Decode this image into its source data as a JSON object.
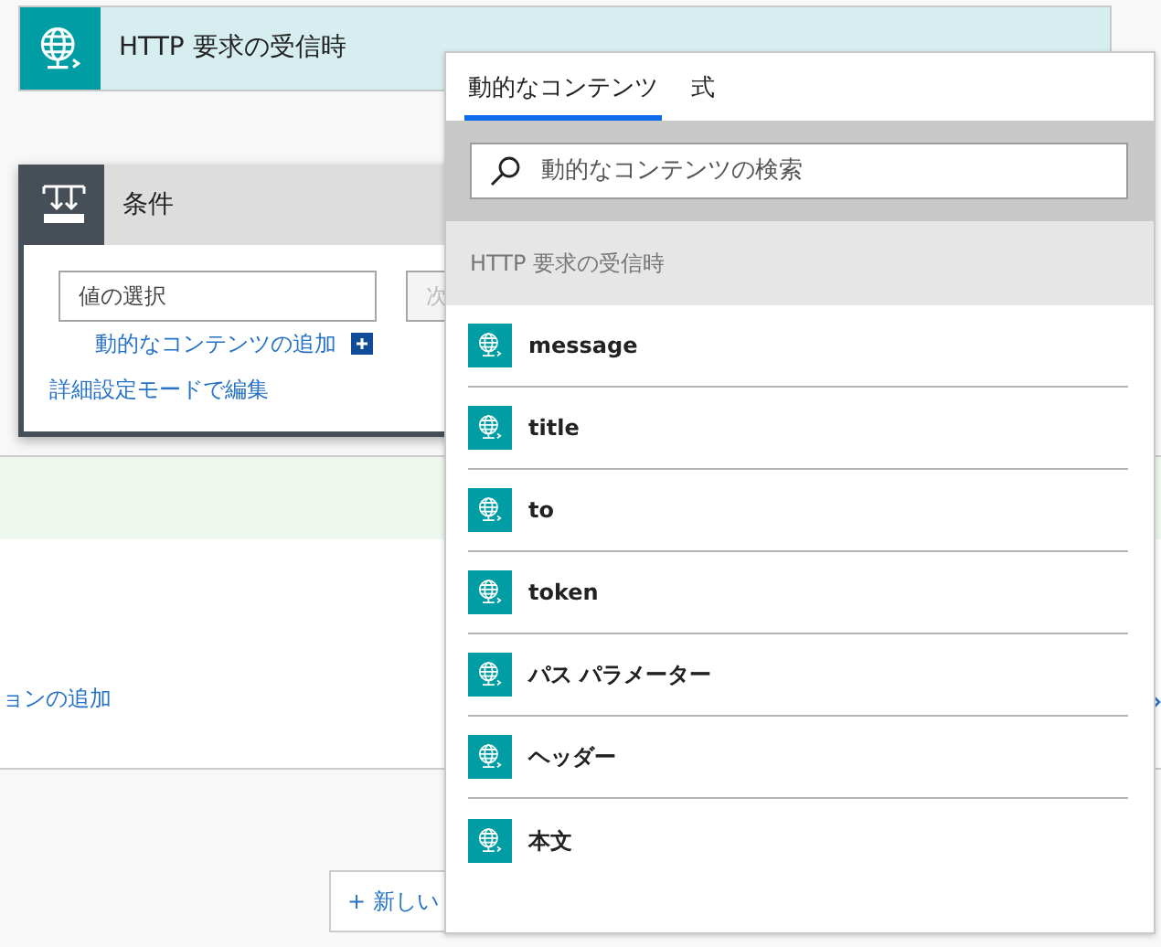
{
  "trigger": {
    "title": "HTTP 要求の受信時"
  },
  "condition": {
    "title": "条件",
    "fields": [
      {
        "placeholder": "値の選択"
      },
      {
        "placeholder": "次"
      }
    ],
    "add_dynamic_link": "動的なコンテンツの追加",
    "advanced_link": "詳細設定モードで編集"
  },
  "action_link": "ョンの追加",
  "new_step_button": "+ 新しい",
  "popup": {
    "tabs": [
      {
        "label": "動的なコンテンツ",
        "selected": true
      },
      {
        "label": "式",
        "selected": false
      }
    ],
    "search": {
      "placeholder": "動的なコンテンツの検索"
    },
    "section": "HTTP 要求の受信時",
    "items": [
      {
        "label": "message"
      },
      {
        "label": "title"
      },
      {
        "label": "to"
      },
      {
        "label": "token"
      },
      {
        "label": "パス パラメーター"
      },
      {
        "label": "ヘッダー"
      },
      {
        "label": "本文"
      }
    ]
  }
}
